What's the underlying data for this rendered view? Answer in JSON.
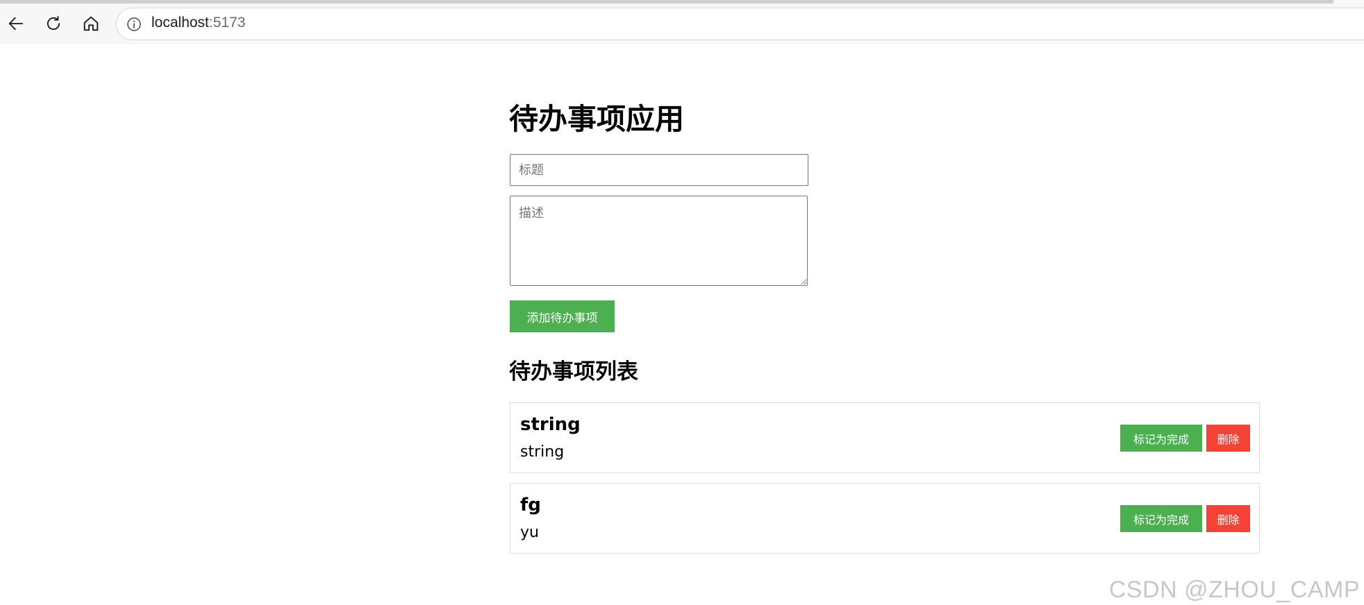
{
  "browser": {
    "url_host": "localhost",
    "url_port": ":5173",
    "icons": [
      "back-arrow-icon",
      "reload-icon",
      "home-icon",
      "info-icon"
    ]
  },
  "app": {
    "title": "待办事项应用",
    "title_placeholder": "标题",
    "description_placeholder": "描述",
    "add_button_label": "添加待办事项",
    "list_heading": "待办事项列表"
  },
  "todos": [
    {
      "title": "string",
      "description": "string",
      "complete_label": "标记为完成",
      "delete_label": "删除"
    },
    {
      "title": "fg",
      "description": "yu",
      "complete_label": "标记为完成",
      "delete_label": "删除"
    }
  ],
  "watermark": "CSDN @ZHOU_CAMP",
  "colors": {
    "primary_green": "#4caf50",
    "danger_red": "#f44336"
  }
}
